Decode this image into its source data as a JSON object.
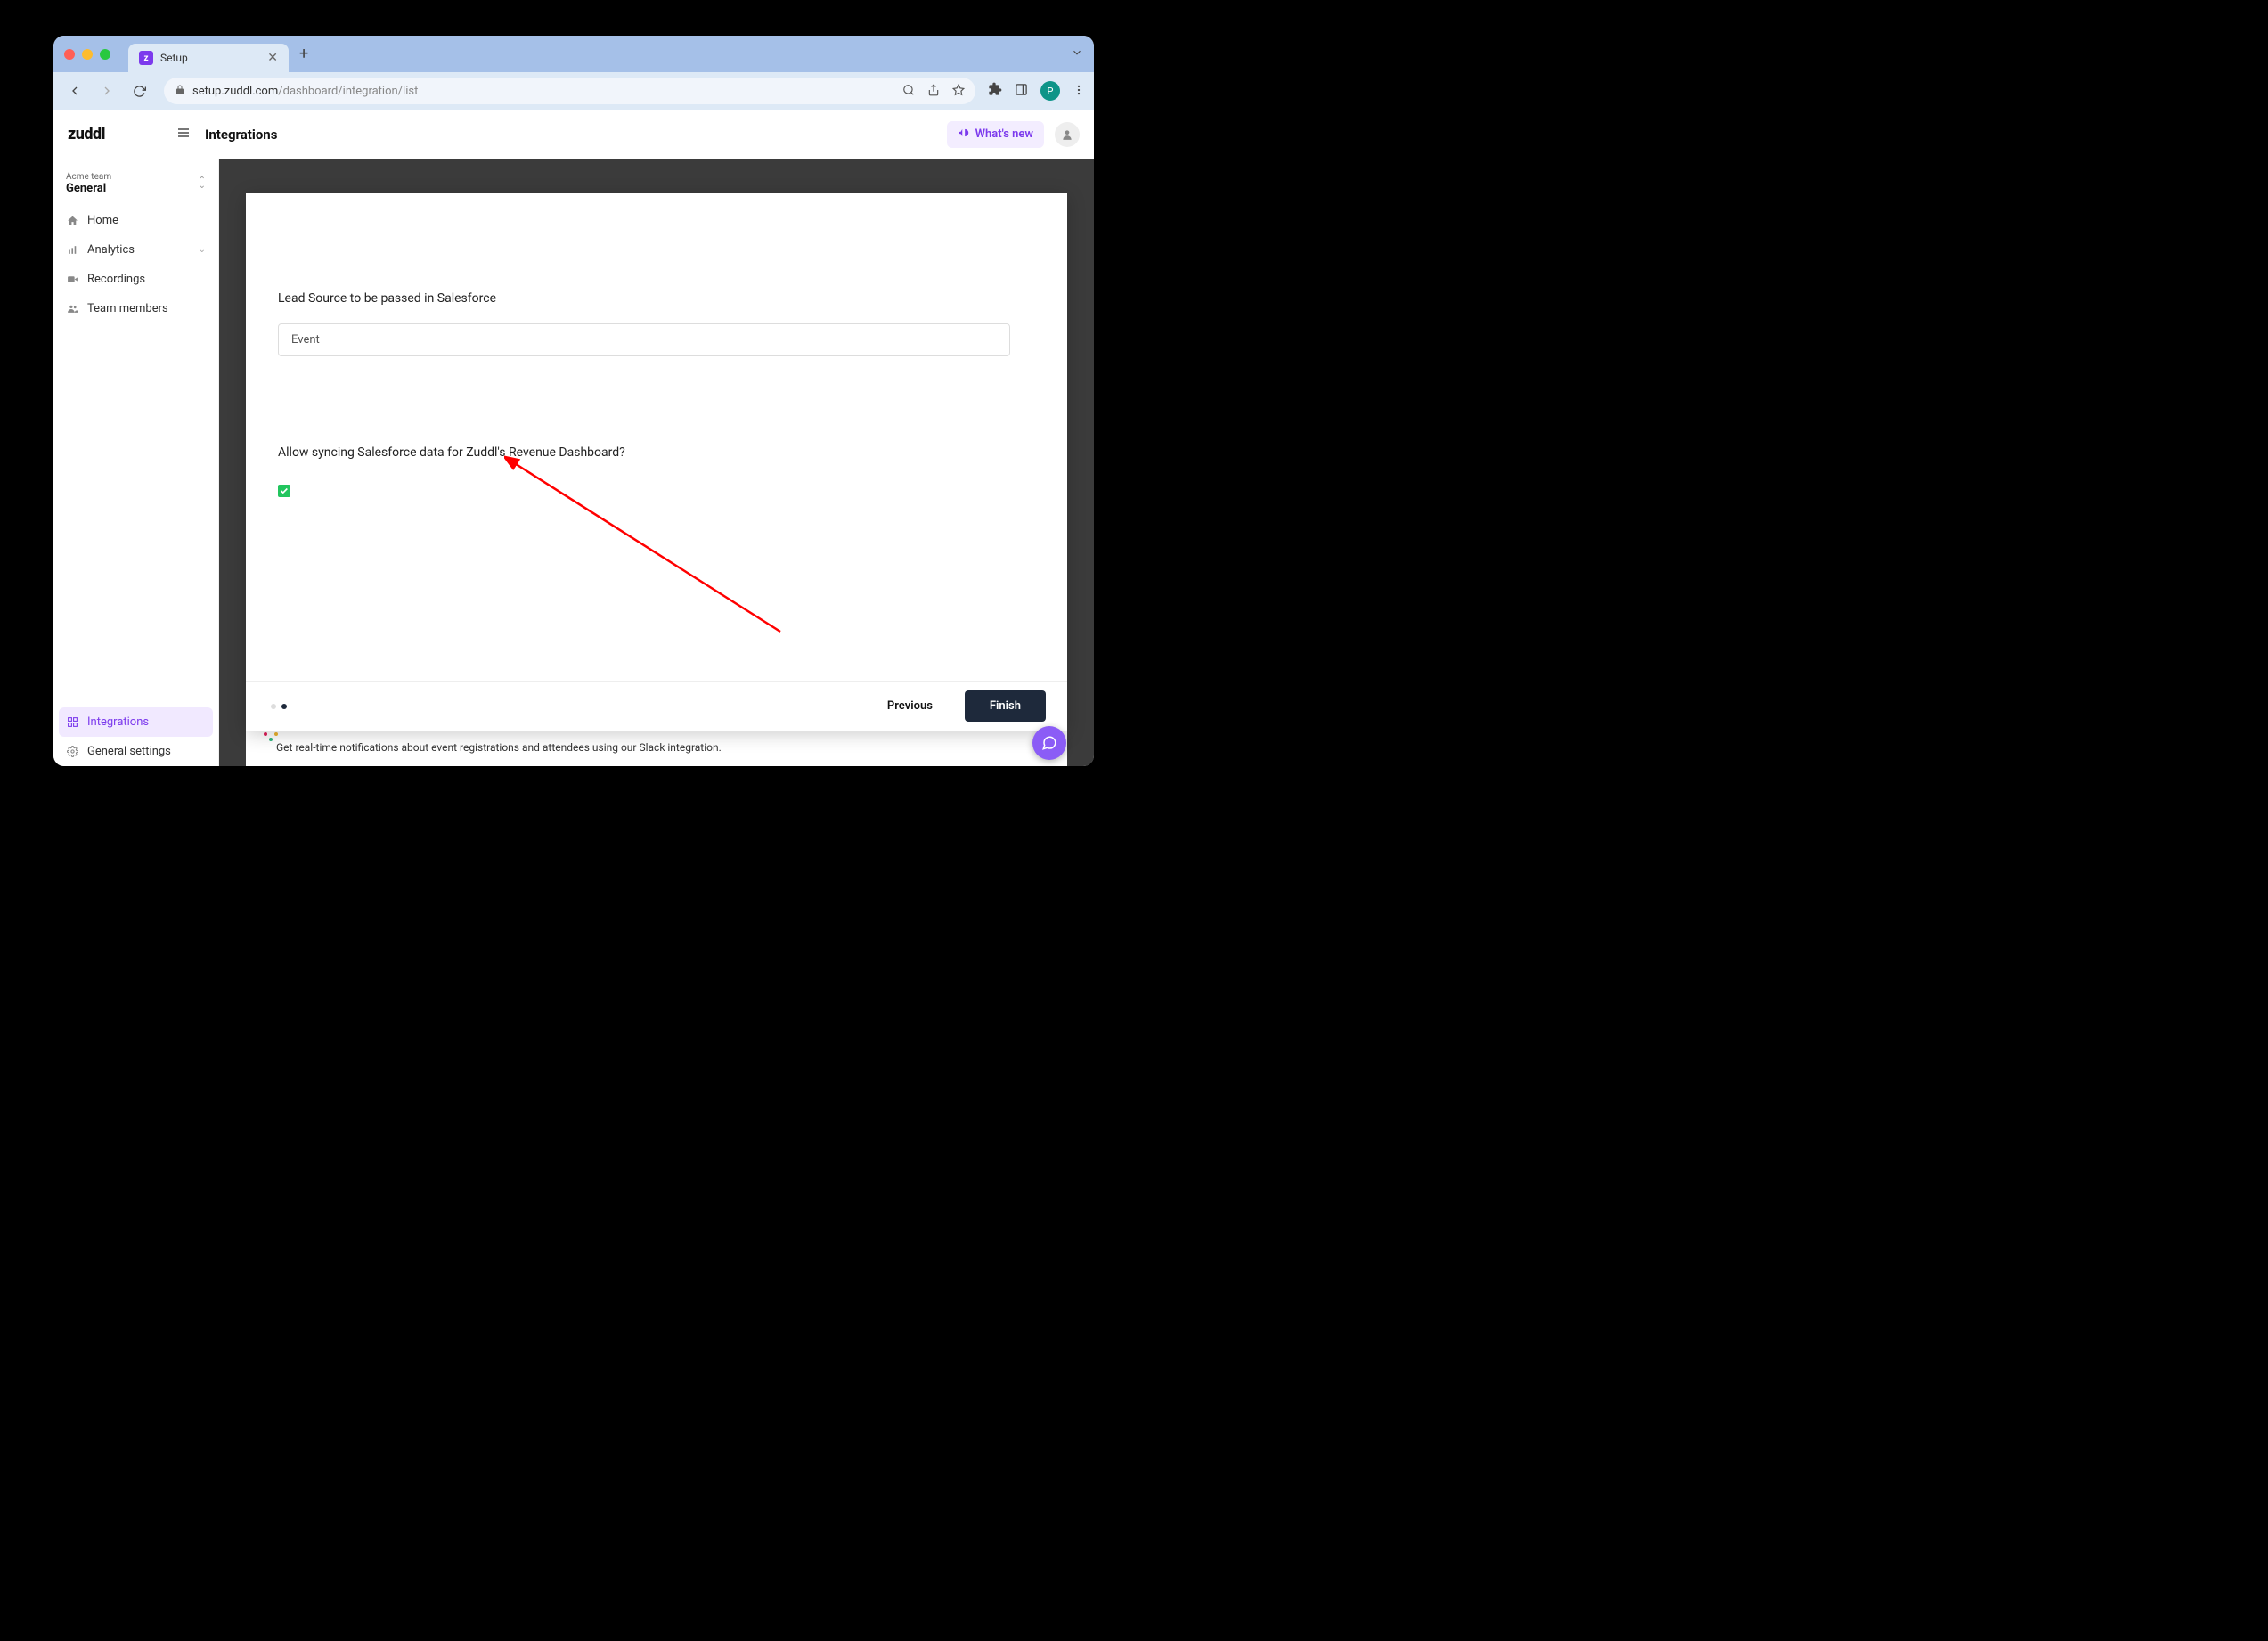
{
  "browser": {
    "tab_title": "Setup",
    "tab_favicon_letter": "z",
    "url_host": "setup.zuddl.com",
    "url_path": "/dashboard/integration/list",
    "profile_letter": "P"
  },
  "header": {
    "logo": "zuddl",
    "page_title": "Integrations",
    "whats_new": "What's new"
  },
  "sidebar": {
    "team_label": "Acme team",
    "team_name": "General",
    "items": [
      {
        "label": "Home"
      },
      {
        "label": "Analytics"
      },
      {
        "label": "Recordings"
      },
      {
        "label": "Team members"
      }
    ],
    "bottom": [
      {
        "label": "Integrations"
      },
      {
        "label": "General settings"
      }
    ]
  },
  "modal": {
    "lead_source_label": "Lead Source to be passed in Salesforce",
    "lead_source_value": "Event",
    "sync_question": "Allow syncing Salesforce data for Zuddl's Revenue Dashboard?",
    "sync_checked": true,
    "previous": "Previous",
    "finish": "Finish"
  },
  "behind": {
    "text": "Get real-time notifications about event registrations and attendees using our Slack integration."
  }
}
